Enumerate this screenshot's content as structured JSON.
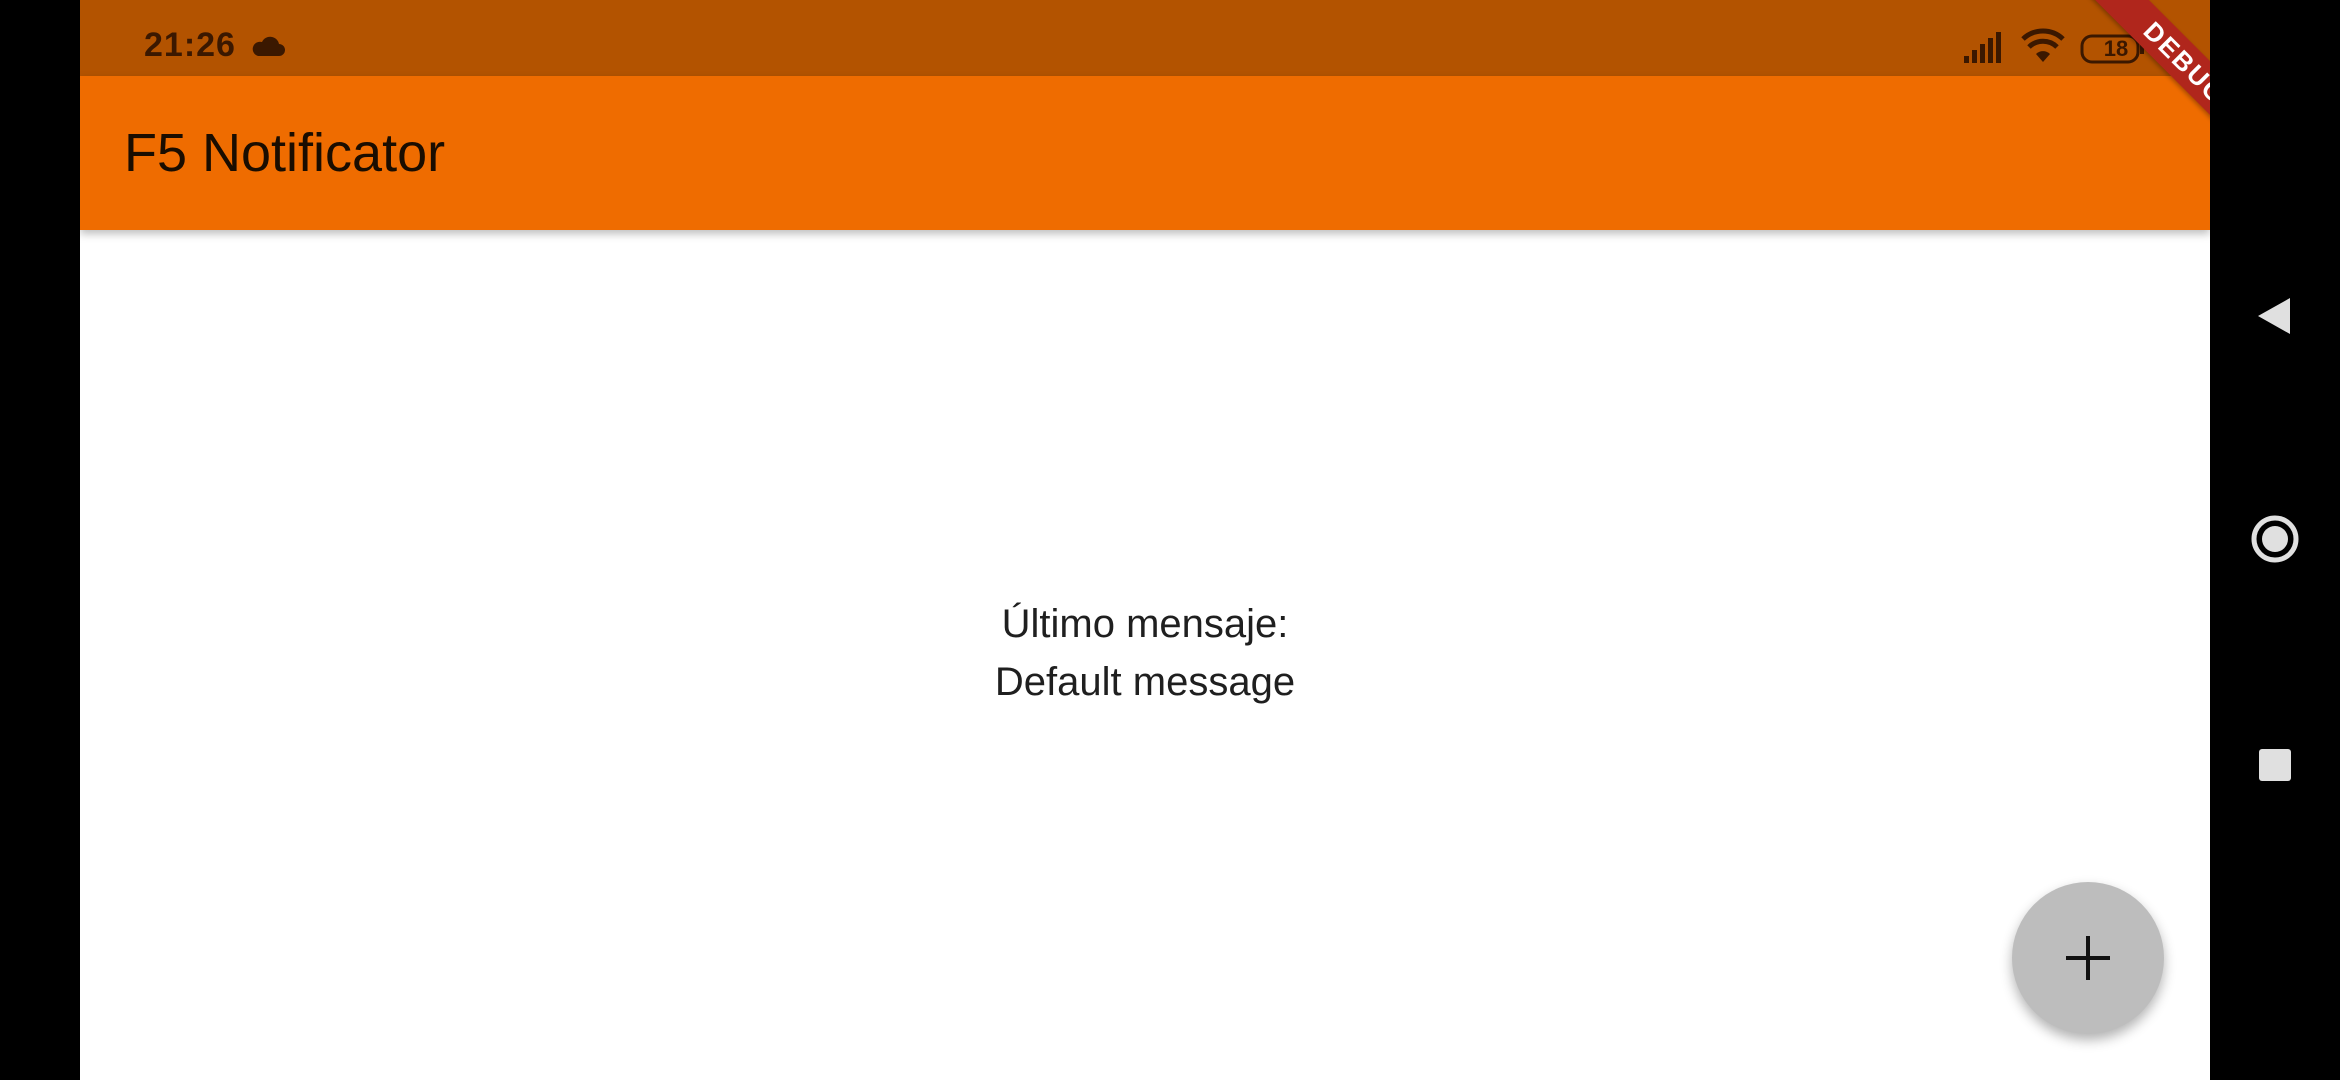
{
  "status_bar": {
    "time": "21:26",
    "battery": "18",
    "icons": [
      "cloud-icon",
      "signal-icon",
      "wifi-icon",
      "battery-icon"
    ]
  },
  "app_bar": {
    "title": "F5 Notificator",
    "background_color": "#ef6c00"
  },
  "debug_banner": {
    "label": "DEBUG"
  },
  "content": {
    "message_label": "Último mensaje:",
    "message_value": "Default message"
  },
  "fab": {
    "icon": "plus-icon",
    "color": "#bdbdbd"
  },
  "nav_bar": {
    "buttons": [
      "back-icon",
      "home-icon",
      "recents-icon"
    ]
  }
}
